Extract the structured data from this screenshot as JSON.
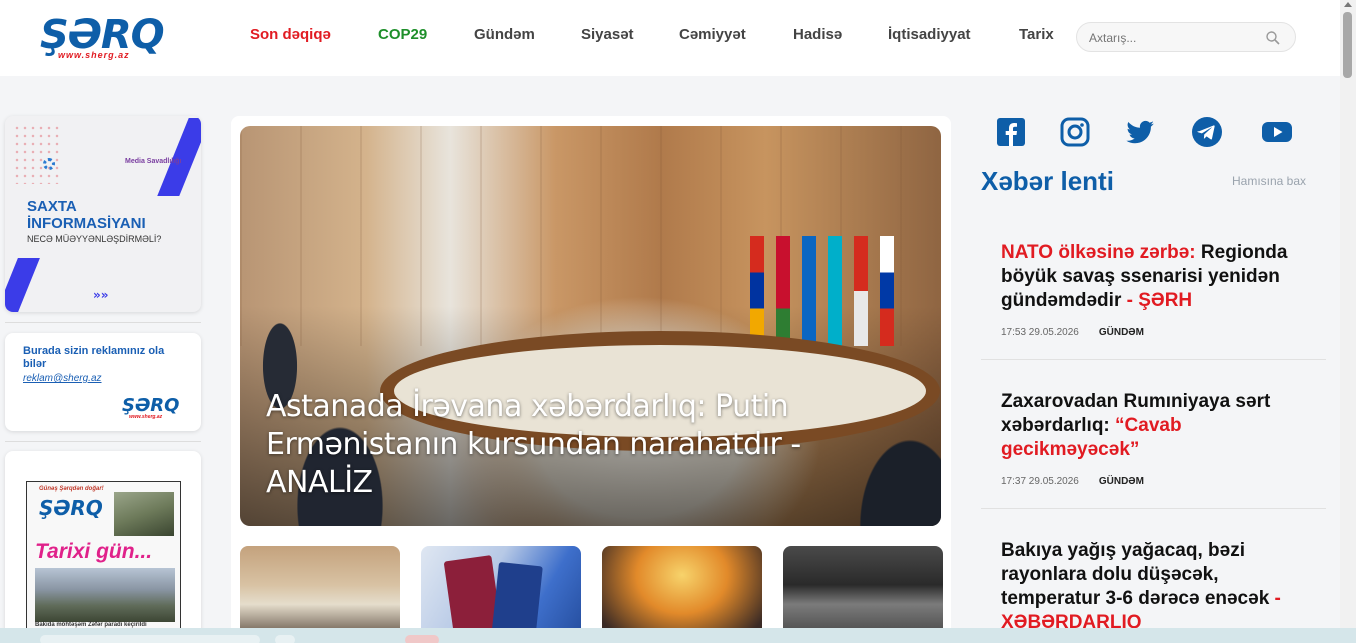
{
  "site": {
    "logo": "ŞƏRQ",
    "logo_sub": "www.sherg.az"
  },
  "nav": [
    {
      "label": "Son dəqiqə",
      "color": "#e11b22"
    },
    {
      "label": "COP29",
      "color": "#1e8f2a"
    },
    {
      "label": "Gündəm",
      "color": "#444444"
    },
    {
      "label": "Siyasət",
      "color": "#444444"
    },
    {
      "label": "Cəmiyyət",
      "color": "#444444"
    },
    {
      "label": "Hadisə",
      "color": "#444444"
    },
    {
      "label": "İqtisadiyyat",
      "color": "#444444"
    },
    {
      "label": "Tarix",
      "color": "#444444"
    }
  ],
  "search": {
    "placeholder": "Axtarış..."
  },
  "ads": {
    "ad1": {
      "title_line1": "SAXTA",
      "title_line2": "İNFORMASİYANI",
      "subtitle": "NECƏ MÜƏYYƏNLƏŞDİRMƏLİ?",
      "org_name": "Media Savadlılığı",
      "chevrons": "»»"
    },
    "ad2": {
      "text": "Burada sizin reklamınız ola bilər",
      "email": "reklam@sherg.az",
      "logo": "ŞƏRQ",
      "logo_sub": "www.sherg.az"
    },
    "ad3": {
      "tagline": "Günəş Şərqdən doğar!",
      "logo": "ŞƏRQ",
      "headline": "Tarixi gün...",
      "caption": "Bakıda möhtəşəm Zəfər paradı keçirildi"
    }
  },
  "hero": {
    "title": "Astanada İrəvana xəbərdarlıq: Putin Ermənistanın kursundan narahatdır - ANALİZ"
  },
  "social": [
    "facebook-icon",
    "instagram-icon",
    "twitter-icon",
    "telegram-icon",
    "youtube-icon"
  ],
  "feed": {
    "title": "Xəbər lenti",
    "see_all": "Hamısına bax",
    "items": [
      {
        "red_lead": "NATO ölkəsinə zərbə:",
        "text": " Regionda böyük savaş ssenarisi yenidən gündəmdədir",
        "red_tail": " - ŞƏRH",
        "time": "17:53 29.05.2026",
        "category": "GÜNDƏM"
      },
      {
        "red_lead": "",
        "text": "Zaxarovadan Rumıniyaya sərt xəbərdarlıq: ",
        "red_tail": "“Cavab gecikməyəcək”",
        "time": "17:37 29.05.2026",
        "category": "GÜNDƏM"
      },
      {
        "red_lead": "",
        "text": "Bakıya yağış yağacaq, bəzi rayonlara dolu düşəcək, temperatur 3-6 dərəcə enəcək",
        "red_tail": " - XƏBƏRDARLIQ",
        "time": "",
        "category": ""
      }
    ]
  },
  "colors": {
    "brand_blue": "#0e5ea8",
    "accent_red": "#e11b22"
  }
}
